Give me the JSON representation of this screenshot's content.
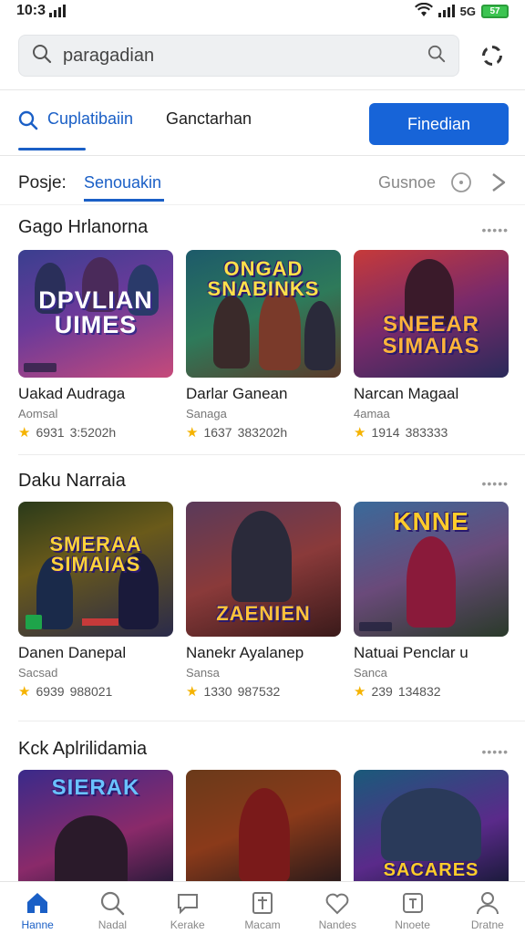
{
  "status_bar": {
    "time": "10:3",
    "network": "5G",
    "battery": "57"
  },
  "search": {
    "placeholder": "Search",
    "value": "paragadian"
  },
  "top_tabs": {
    "items": [
      {
        "label": "Cuplatibaiin",
        "active": true
      },
      {
        "label": "Ganctarhan",
        "active": false
      }
    ],
    "primary_button": "Finedian"
  },
  "filter_row": {
    "label": "Posje:",
    "active_tab": "Senouakin",
    "right_label": "Gusnoe"
  },
  "sections": [
    {
      "title": "Gago Hrlanorna",
      "more": "•••••",
      "cards": [
        {
          "thumb_title": "DPVLIAN UIMES",
          "title": "Uakad Audraga",
          "sub": "Aomsal",
          "rating": "6931",
          "meta": "3:5202h"
        },
        {
          "thumb_title": "ONGAD SNABINKS",
          "title": "Darlar Ganean",
          "sub": "Sanaga",
          "rating": "1637",
          "meta": "383202h"
        },
        {
          "thumb_title": "SNEEAR SIMAIAS",
          "title": "Narcan Magaal",
          "sub": "4amaa",
          "rating": "1914",
          "meta": "383333"
        }
      ]
    },
    {
      "title": "Daku Narraia",
      "more": "•••••",
      "cards": [
        {
          "thumb_title": "SMERAA SIMAIAS",
          "title": "Danen Danepal",
          "sub": "Sacsad",
          "rating": "6939",
          "meta": "988021"
        },
        {
          "thumb_title": "ZAENIEN",
          "title": "Nanekr Ayalanep",
          "sub": "Sansa",
          "rating": "1330",
          "meta": "987532"
        },
        {
          "thumb_title": "KNNE",
          "title": "Natuai Penclar u",
          "sub": "Sanca",
          "rating": "239",
          "meta": "134832"
        }
      ]
    },
    {
      "title": "Kck Aplrilidamia",
      "more": "•••••",
      "cards": [
        {
          "thumb_title": "SIERAK",
          "title": "",
          "sub": "",
          "rating": "",
          "meta": ""
        },
        {
          "thumb_title": "",
          "title": "",
          "sub": "",
          "rating": "",
          "meta": ""
        },
        {
          "thumb_title": "SACARES",
          "title": "",
          "sub": "",
          "rating": "",
          "meta": ""
        }
      ]
    }
  ],
  "bottom_nav": [
    {
      "label": "Hanne",
      "icon": "home-icon",
      "active": true
    },
    {
      "label": "Nadal",
      "icon": "search-icon",
      "active": false
    },
    {
      "label": "Kerake",
      "icon": "chat-icon",
      "active": false
    },
    {
      "label": "Macam",
      "icon": "book-icon",
      "active": false
    },
    {
      "label": "Nandes",
      "icon": "heart-icon",
      "active": false
    },
    {
      "label": "Nnoete",
      "icon": "tv-icon",
      "active": false
    },
    {
      "label": "Dratne",
      "icon": "profile-icon",
      "active": false
    }
  ],
  "colors": {
    "accent": "#1a5fc6",
    "button": "#1764d8",
    "star": "#f5b301"
  }
}
